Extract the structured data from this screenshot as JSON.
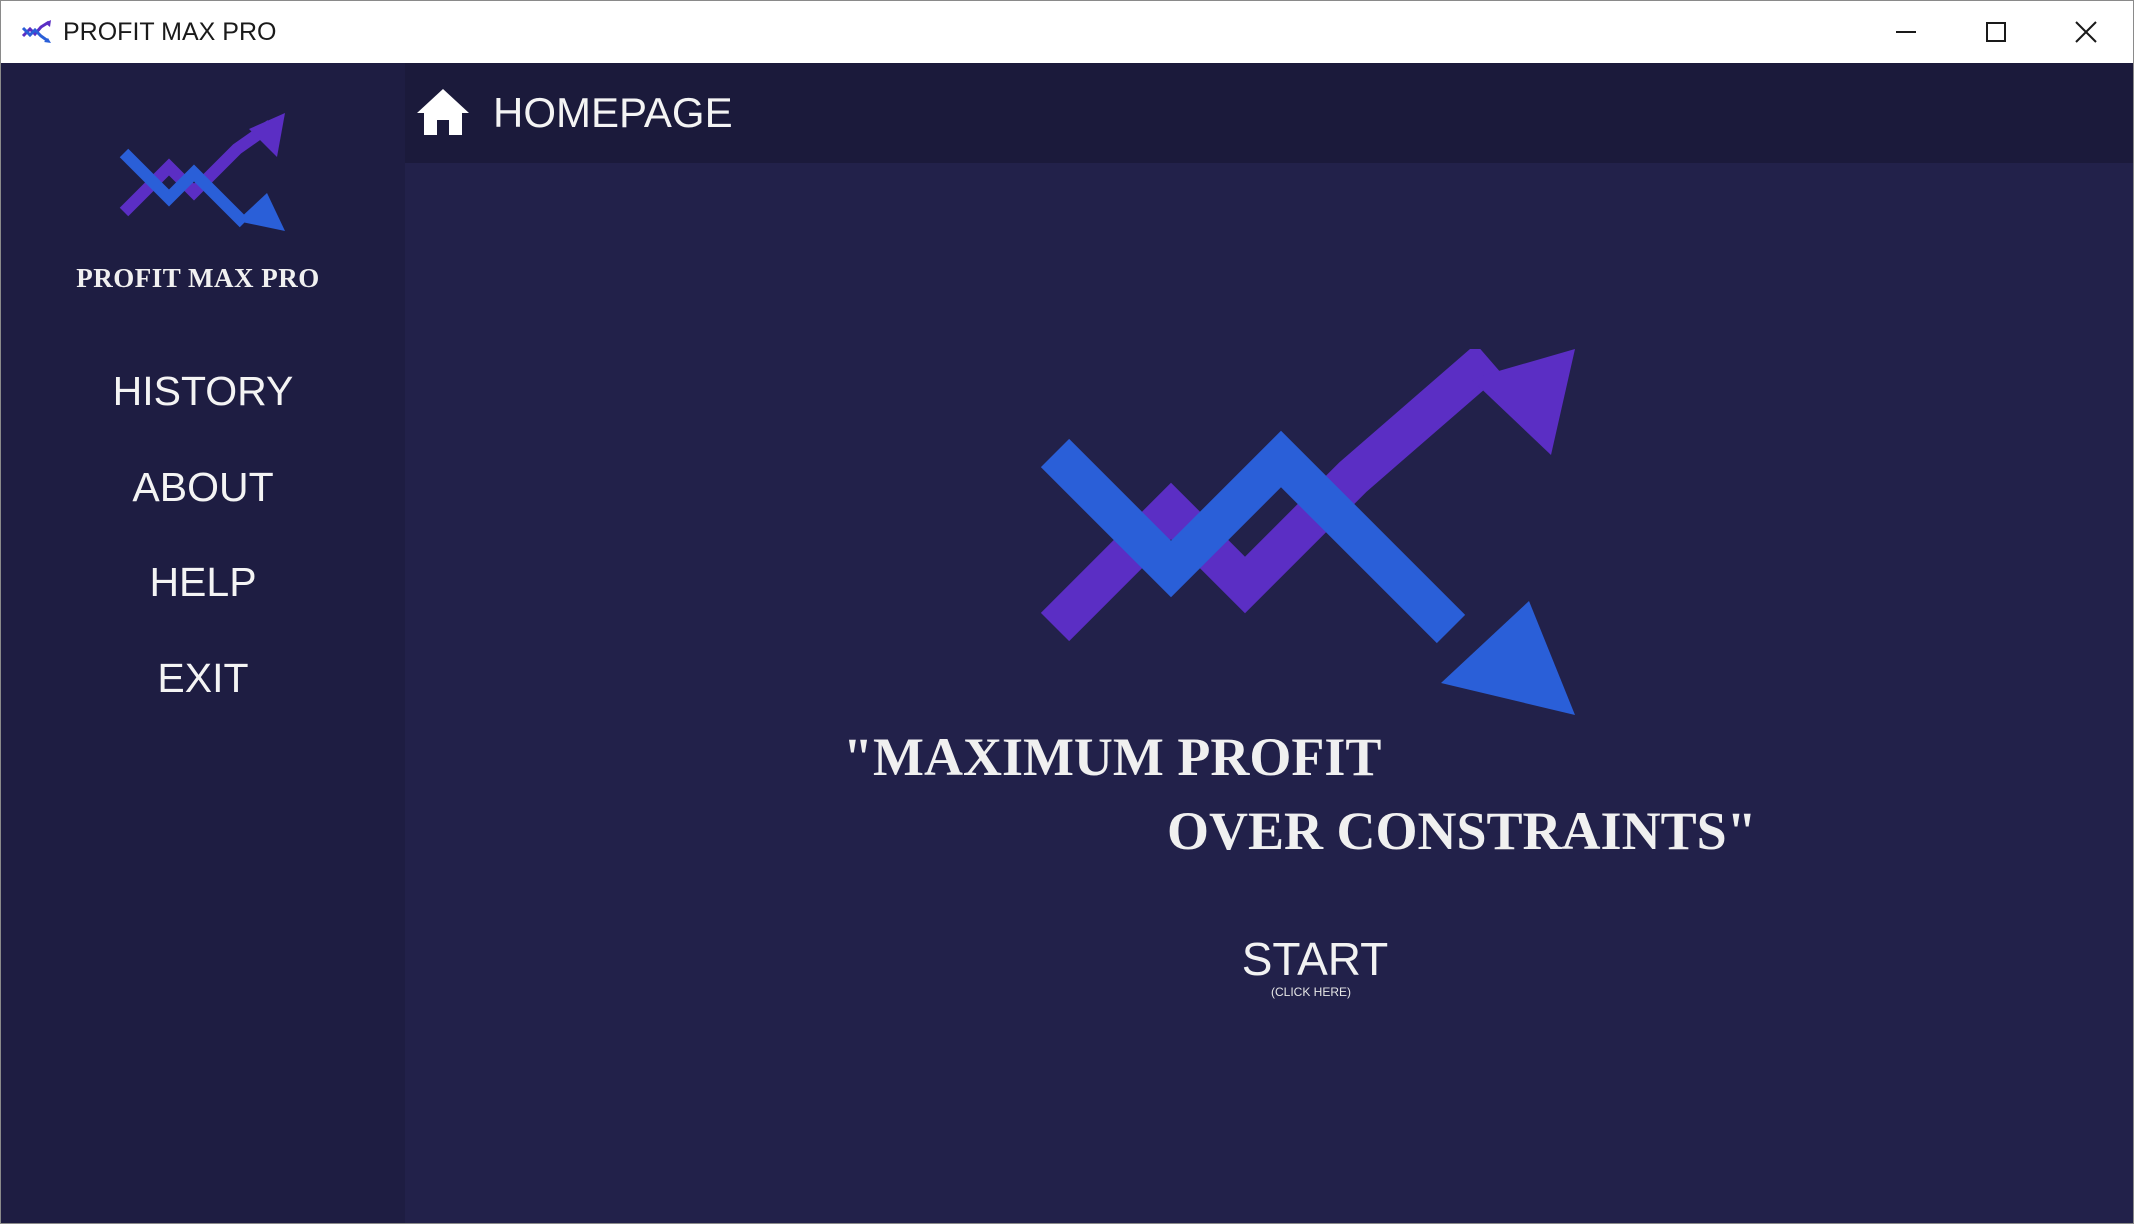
{
  "window": {
    "title": "PROFIT MAX PRO",
    "app_icon": "profit-arrows-icon",
    "controls": {
      "minimize_icon": "minimize-icon",
      "maximize_icon": "maximize-icon",
      "close_icon": "close-icon"
    }
  },
  "sidebar": {
    "brand": "PROFIT MAX PRO",
    "logo_icon": "profit-arrows-logo",
    "items": [
      {
        "label": "HISTORY"
      },
      {
        "label": "ABOUT"
      },
      {
        "label": "HELP"
      },
      {
        "label": "EXIT"
      }
    ]
  },
  "header": {
    "icon": "home-icon",
    "title": "HOMEPAGE"
  },
  "main": {
    "hero_icon": "profit-arrows-logo",
    "quote_line1": "\"MAXIMUM PROFIT",
    "quote_line2": "OVER CONSTRAINTS\"",
    "start_label": "START",
    "start_sub": "(CLICK HERE)"
  },
  "colors": {
    "sidebar_bg": "#1e1d42",
    "header_bg": "#1b1a3b",
    "main_bg": "#22214a",
    "arrow_blue": "#2a5fd8",
    "arrow_purple": "#5b2ec4",
    "text": "#f4f4f4"
  }
}
